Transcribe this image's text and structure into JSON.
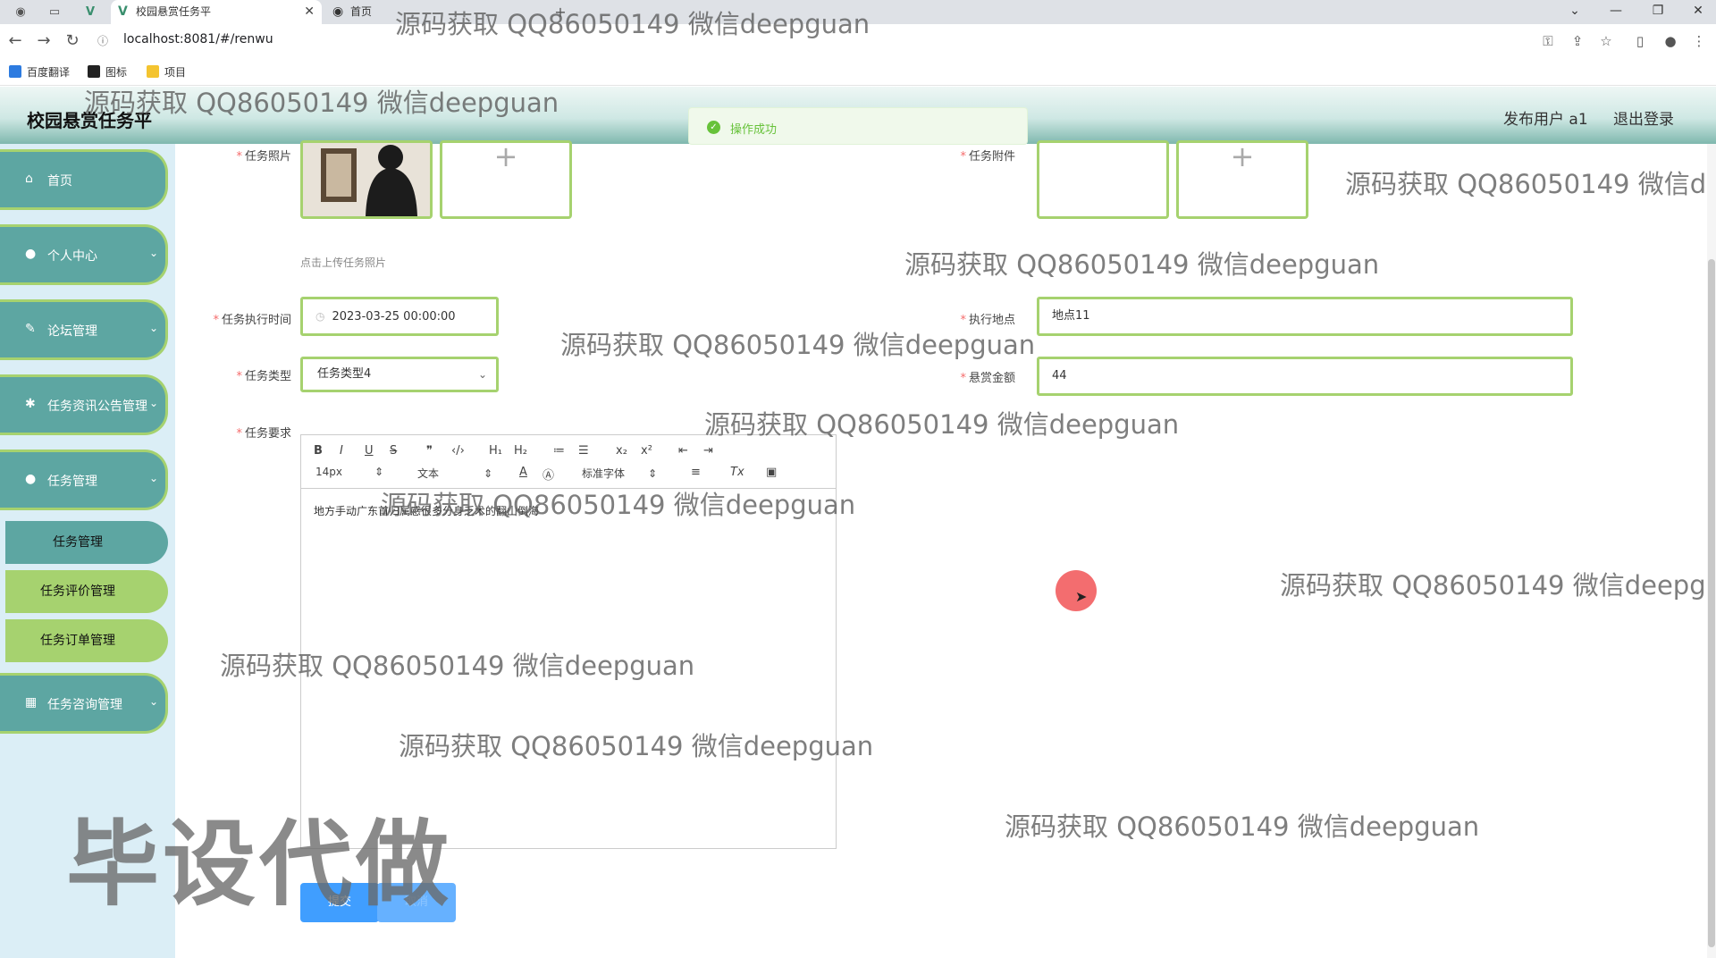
{
  "browser": {
    "active_tab_title": "校园悬赏任务平",
    "second_tab_title": "首页",
    "url": "localhost:8081/#/renwu",
    "bookmarks": [
      "百度翻译",
      "图标",
      "项目"
    ]
  },
  "header": {
    "title": "校园悬赏任务平",
    "user_label": "发布用户 a1",
    "logout_label": "退出登录"
  },
  "toast": {
    "message": "操作成功",
    "color": "#67c23a"
  },
  "sidebar": {
    "items": [
      {
        "label": "首页",
        "icon": "home-icon"
      },
      {
        "label": "个人中心",
        "icon": "user-icon"
      },
      {
        "label": "论坛管理",
        "icon": "forum-icon"
      },
      {
        "label": "任务资讯公告管理",
        "icon": "news-icon"
      },
      {
        "label": "任务管理",
        "icon": "user-icon"
      },
      {
        "label": "任务咨询管理",
        "icon": "grid-icon"
      }
    ],
    "subitems": [
      "任务管理",
      "任务评价管理",
      "任务订单管理"
    ]
  },
  "form": {
    "photo_label": "任务照片",
    "photo_hint": "点击上传任务照片",
    "attachment_label": "任务附件",
    "exec_time_label": "任务执行时间",
    "exec_time_value": "2023-03-25 00:00:00",
    "location_label": "执行地点",
    "location_value": "地点11",
    "type_label": "任务类型",
    "type_value": "任务类型4",
    "reward_label": "悬赏金额",
    "reward_value": "44",
    "requirement_label": "任务要求",
    "editor": {
      "font_size": "14px",
      "block_format": "文本",
      "font_family": "标准字体",
      "content": "地方手动广东首归属感很多分身乏术的翻山倒海"
    },
    "submit_label": "提交",
    "cancel_label": "取消"
  },
  "watermarks": {
    "text": "源码获取 QQ86050149 微信deepguan",
    "big_text": "毕设代做"
  },
  "colors": {
    "accent": "#5da6a2",
    "border_green": "#a6d26f",
    "primary_blue": "#409eff"
  }
}
